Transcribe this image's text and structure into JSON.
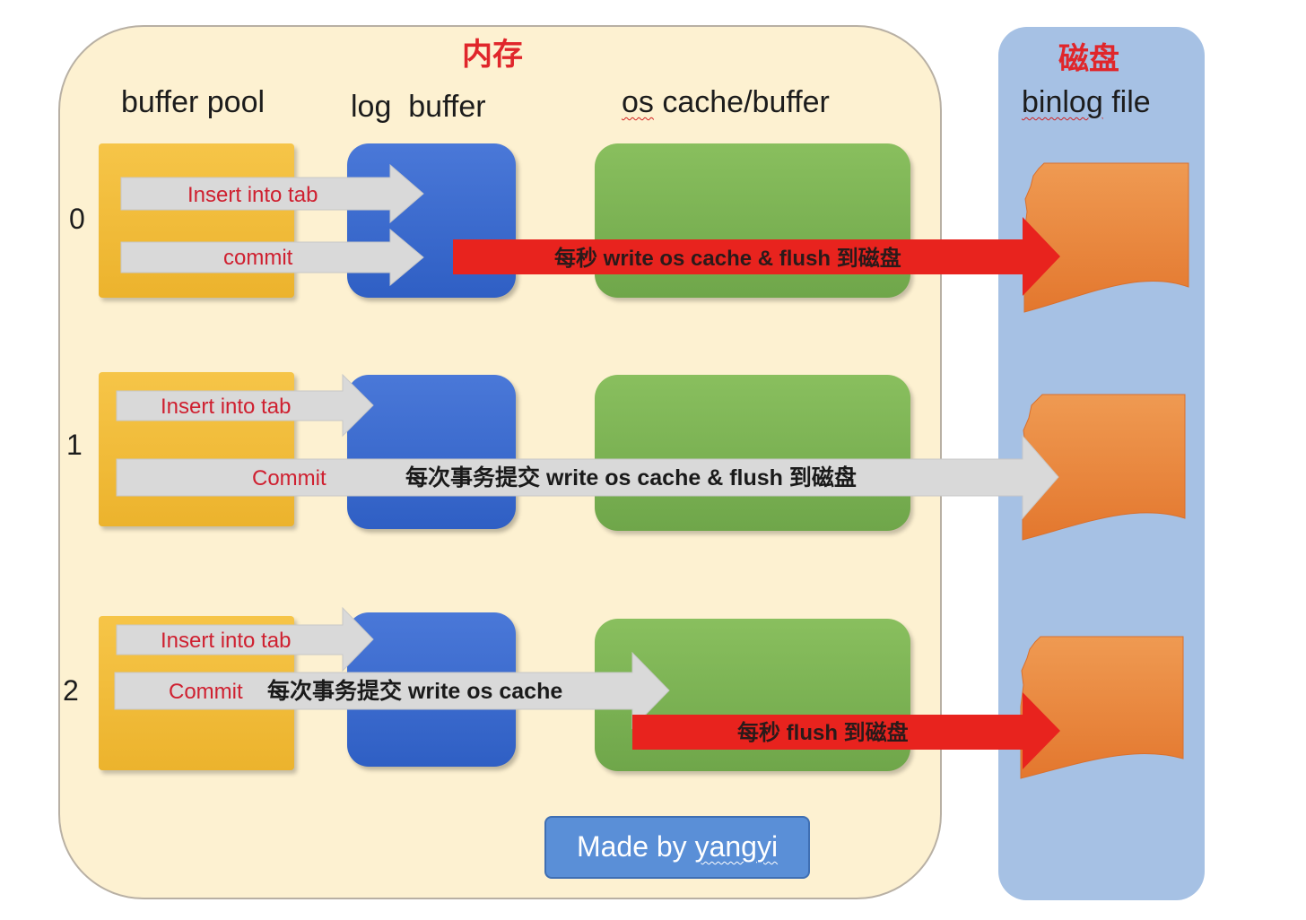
{
  "panels": {
    "memory_title": "内存",
    "disk_title": "磁盘"
  },
  "columns": {
    "buffer_pool": "buffer pool",
    "log_buffer": "log  buffer",
    "os_cache_word": "os",
    "os_cache_rest": " cache/buffer",
    "binlog_word": "binlog",
    "binlog_rest": " file"
  },
  "rows": [
    {
      "number": "0",
      "insert_label": "Insert into tab",
      "commit_label": "commit",
      "action_label": "每秒 write os cache & flush 到磁盘"
    },
    {
      "number": "1",
      "insert_label": "Insert into tab",
      "commit_label": "Commit",
      "action_label": "每次事务提交 write os cache & flush 到磁盘"
    },
    {
      "number": "2",
      "insert_label": "Insert into tab",
      "commit_label": "Commit",
      "action_label": "每次事务提交 write os cache",
      "flush_label": "每秒 flush 到磁盘"
    }
  ],
  "credit": {
    "prefix": "Made by ",
    "author": "yangyi"
  },
  "colors": {
    "memory_bg": "#fdf1d1",
    "disk_bg": "#a6c1e4",
    "buffer_pool": "#f2b632",
    "log_buffer": "#3a69cf",
    "os_cache": "#7bb153",
    "binlog_file": "#e8833a",
    "gray_arrow": "#d9d9d9",
    "red_arrow": "#e8231e",
    "title_red": "#e0262b"
  }
}
